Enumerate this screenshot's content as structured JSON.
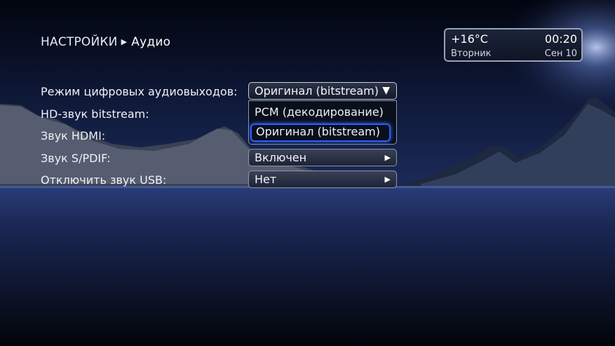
{
  "header": {
    "breadcrumb_root": "НАСТРОЙКИ",
    "separator_icon": "play-triangle",
    "breadcrumb_current": "Аудио"
  },
  "widget": {
    "temperature": "+16°C",
    "time": "00:20",
    "day": "Вторник",
    "date": "Сен 10",
    "icon": "crescent-moon-icon"
  },
  "settings": [
    {
      "label": "Режим цифровых аудиовыходов:",
      "value": "Оригинал (bitstream)",
      "control": "dropdown-open"
    },
    {
      "label": "HD-звук bitstream:",
      "value": "",
      "control": "hidden"
    },
    {
      "label": "Звук HDMI:",
      "value": "",
      "control": "hidden"
    },
    {
      "label": "Звук S/PDIF:",
      "value": "Включен",
      "control": "selector"
    },
    {
      "label": "Отключить звук USB:",
      "value": "Нет",
      "control": "selector"
    }
  ],
  "dropdown": {
    "options": [
      "PCM (декодирование)",
      "Оригинал (bitstream)"
    ],
    "selected_index": 1
  },
  "colors": {
    "focus": "#2c5bff",
    "sky": "#1a2b5c",
    "text": "#f0f2f7"
  }
}
